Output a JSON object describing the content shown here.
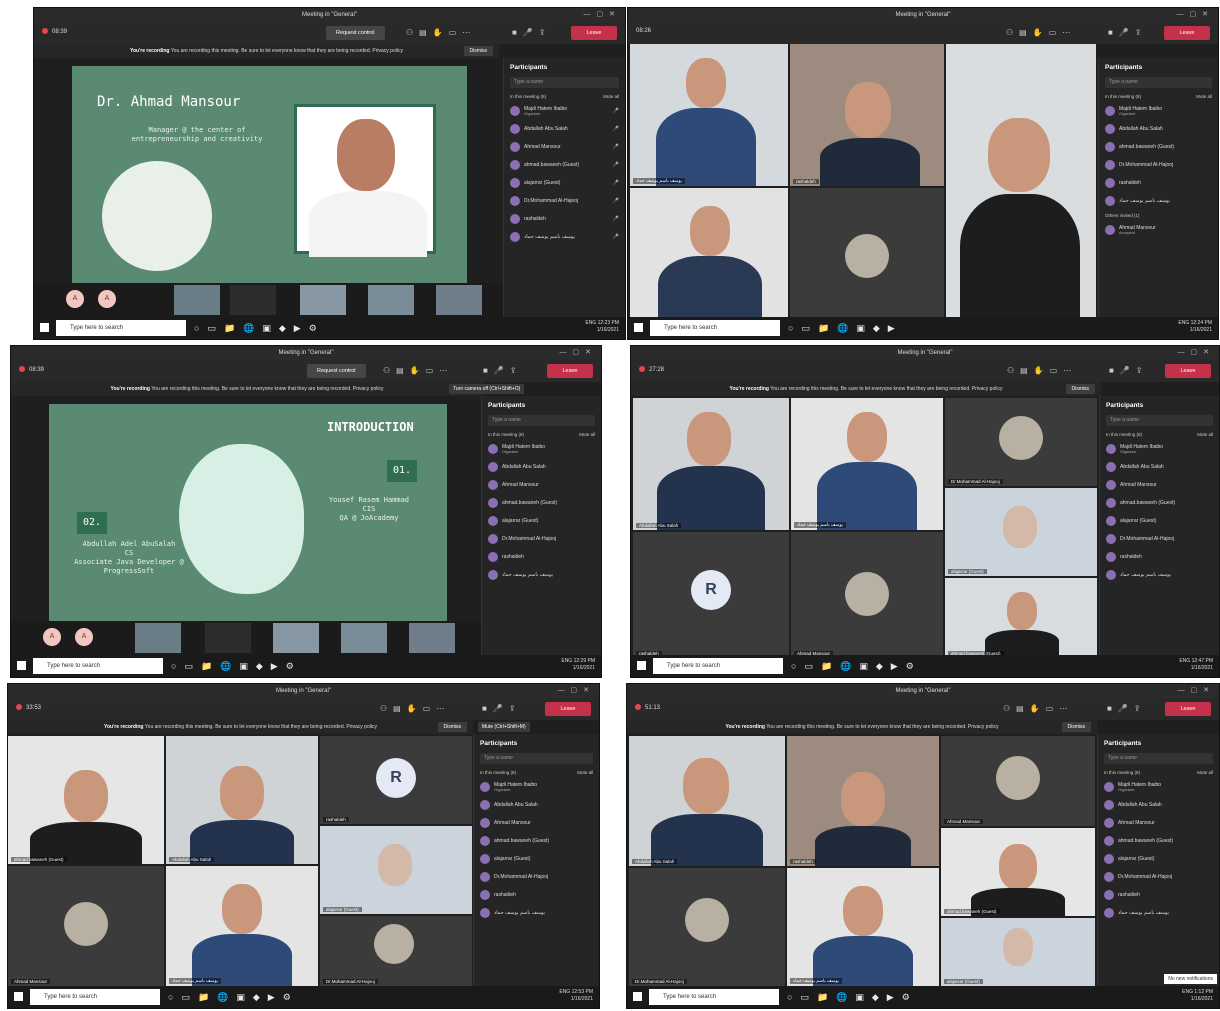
{
  "common": {
    "title": "Meeting in \"General\"",
    "request_control": "Request control",
    "leave": "Leave",
    "banner_lead": "You're recording",
    "banner_text": "You are recording this meeting. Be sure to let everyone know that they are being recorded. Privacy policy",
    "dismiss": "Dismiss",
    "participants": "Participants",
    "search_placeholder": "Type a name",
    "in_meeting": "In this meeting (8)",
    "mute_all": "Mute all",
    "taskbar_search": "Type here to search",
    "lang": "ENG"
  },
  "participants": [
    {
      "name": "Majdi Hatem Ibaibo",
      "role": "Organizer"
    },
    {
      "name": "Abdallah Abu Salah",
      "role": ""
    },
    {
      "name": "Ahmad Mansour",
      "role": ""
    },
    {
      "name": "ahmad.bawaneh (Guest)",
      "role": ""
    },
    {
      "name": "alajarrar (Guest)",
      "role": ""
    },
    {
      "name": "Dr.Mohammad Al-Hajooj",
      "role": ""
    },
    {
      "name": "rashaldeh",
      "role": ""
    },
    {
      "name": "يوسف باسم يوسف حماد",
      "role": ""
    }
  ],
  "shots": [
    {
      "timer": "08:39",
      "time": "12:23 PM",
      "date": "1/16/2021"
    },
    {
      "timer": "08:26",
      "time": "12:24 PM",
      "date": "1/16/2021",
      "others_invited": "Others invited (1)",
      "invited_name": "Ahmad Mansour",
      "invited_status": "Accepted"
    },
    {
      "timer": "08:39",
      "time": "12:29 PM",
      "date": "1/16/2021",
      "tooltip": "Turn camera off (Ctrl+Shift+O)"
    },
    {
      "timer": "27:28",
      "time": "12:47 PM",
      "date": "1/16/2021"
    },
    {
      "timer": "33:53",
      "time": "12:53 PM",
      "date": "1/16/2021",
      "tooltip": "Mute (Ctrl+Shift+M)"
    },
    {
      "timer": "51:13",
      "time": "1:12 PM",
      "date": "1/16/2021",
      "notice": "No new notifications"
    }
  ],
  "slide1": {
    "title": "Dr. Ahmad Mansour",
    "subtitle": "Manager @ the center of entrepreneurship and creativity"
  },
  "slide2": {
    "title": "INTRODUCTION",
    "num1": "01.",
    "p1_name": "Yousef Rasem Hammad",
    "p1_dept": "CIS",
    "p1_role": "QA @ JoAcademy",
    "num2": "02.",
    "p2_name": "Abdullah Adel AbuSalah",
    "p2_dept": "CS",
    "p2_role": "Associate Java Developer @ ProgressSoft"
  },
  "tile_names": {
    "yousef": "يوسف باسم يوسف حماد",
    "rashaldeh": "rashaldeh",
    "abdallah": "Abdallah Abu Salah",
    "hajooj": "Dr.Mohammad Al-Hajooj",
    "bawaneh": "ahmad.bawaneh (Guest)",
    "alajarrar": "alajarrar (Guest)",
    "mansour": "Ahmad Mansour"
  },
  "avatar_letter": "R",
  "colors": {
    "leave": "#c4314b",
    "slide": "#5b8a72",
    "accent": "#8a6fb5"
  }
}
